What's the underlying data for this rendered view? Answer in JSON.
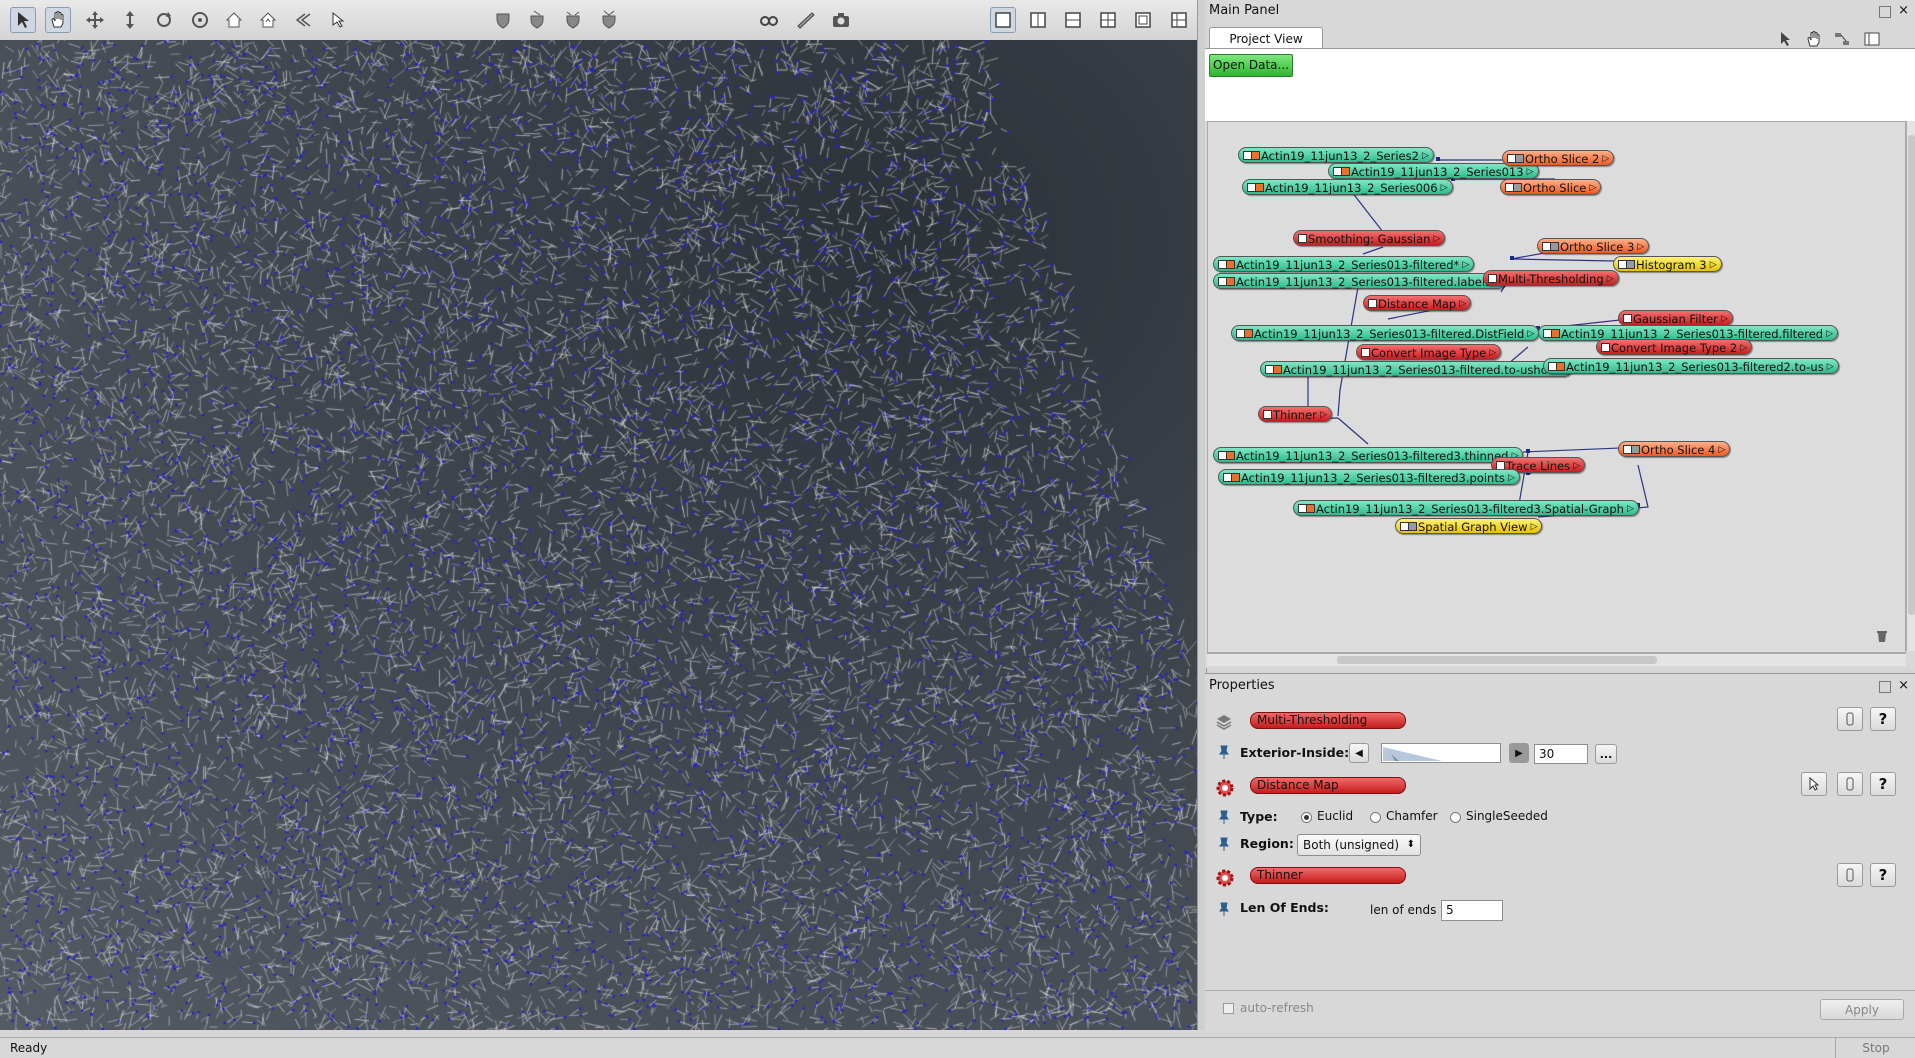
{
  "toolbar": {
    "tools": [
      "pointer-icon",
      "hand-icon",
      "translate-icon",
      "dolly-icon",
      "rotate-icon",
      "trackball-icon",
      "home-icon",
      "set-home-icon",
      "view-all-icon",
      "seek-icon",
      "pick-icon",
      "measure-icon",
      "clip-icon",
      "clip-left-icon",
      "clip-right-icon",
      "stereo-icon",
      "measurement-icon",
      "snapshot-icon"
    ],
    "layouts": [
      "layout-single-icon",
      "layout-two-vertical-icon",
      "layout-two-horizontal-icon",
      "layout-four-icon",
      "layout-fullscreen-icon",
      "layout-custom-icon"
    ]
  },
  "main_panel": {
    "title": "Main Panel",
    "tab": "Project View",
    "open_data": "Open Data..."
  },
  "graph": {
    "nodes": [
      {
        "label": "Actin19_11jun13_2_Series2",
        "kind": "data"
      },
      {
        "label": "Actin19_11jun13_2_Series013",
        "kind": "data"
      },
      {
        "label": "Actin19_11jun13_2_Series006",
        "kind": "data"
      },
      {
        "label": "Ortho Slice 2",
        "kind": "disp"
      },
      {
        "label": "Ortho Slice",
        "kind": "disp"
      },
      {
        "label": "Smoothing: Gaussian",
        "kind": "comp"
      },
      {
        "label": "Actin19_11jun13_2_Series013-filtered*",
        "kind": "data"
      },
      {
        "label": "Actin19_11jun13_2_Series013-filtered.labels",
        "kind": "data"
      },
      {
        "label": "Ortho Slice 3",
        "kind": "disp"
      },
      {
        "label": "Histogram 3",
        "kind": "disp2"
      },
      {
        "label": "Multi-Thresholding",
        "kind": "comp"
      },
      {
        "label": "Distance Map",
        "kind": "comp"
      },
      {
        "label": "Gaussian Filter",
        "kind": "comp"
      },
      {
        "label": "Actin19_11jun13_2_Series013-filtered.DistField",
        "kind": "data"
      },
      {
        "label": "Actin19_11jun13_2_Series013-filtered.filtered",
        "kind": "data"
      },
      {
        "label": "Convert Image Type",
        "kind": "comp"
      },
      {
        "label": "Convert Image Type 2",
        "kind": "comp"
      },
      {
        "label": "Actin19_11jun13_2_Series013-filtered.to-ushort",
        "kind": "data"
      },
      {
        "label": "Actin19_11jun13_2_Series013-filtered2.to-us",
        "kind": "data"
      },
      {
        "label": "Thinner",
        "kind": "comp"
      },
      {
        "label": "Actin19_11jun13_2_Series013-filtered3.thinned",
        "kind": "data"
      },
      {
        "label": "Ortho Slice 4",
        "kind": "disp"
      },
      {
        "label": "Trace Lines",
        "kind": "comp"
      },
      {
        "label": "Actin19_11jun13_2_Series013-filtered3.points",
        "kind": "data"
      },
      {
        "label": "Actin19_11jun13_2_Series013-filtered3.Spatial-Graph",
        "kind": "data"
      },
      {
        "label": "Spatial Graph View",
        "kind": "disp2"
      }
    ]
  },
  "properties": {
    "title": "Properties",
    "multi_thresholding": {
      "module": "Multi-Thresholding",
      "label": "Exterior-Inside:",
      "value": "30",
      "more": "..."
    },
    "distance_map": {
      "module": "Distance Map",
      "type_label": "Type:",
      "type_options": [
        "Euclid",
        "Chamfer",
        "SingleSeeded"
      ],
      "type_selected": "Euclid",
      "region_label": "Region:",
      "region_value": "Both (unsigned)"
    },
    "thinner": {
      "module": "Thinner",
      "label": "Len Of Ends:",
      "field_label": "len of ends",
      "value": "5"
    },
    "auto_refresh": "auto-refresh",
    "apply": "Apply",
    "help": "?"
  },
  "status": {
    "text": "Ready",
    "stop": "Stop"
  }
}
